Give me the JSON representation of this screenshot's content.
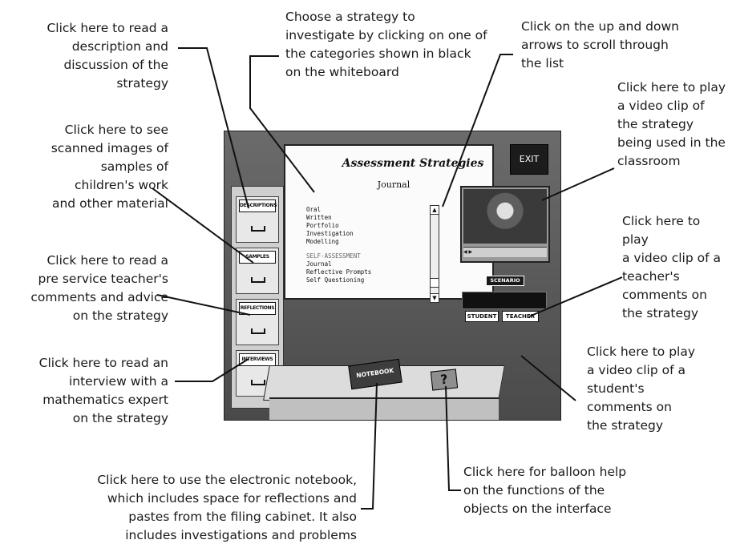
{
  "callouts": {
    "descriptions": "Click here to read a\ndescription and\ndiscussion of the\nstrategy",
    "samples": "Click here to see\nscanned images of\nsamples of\nchildren's work\nand other material",
    "reflections": "Click here to read a\npre service teacher's\ncomments and advice\non the strategy",
    "interviews": "Click here to read an\ninterview with a\nmathematics expert\non the strategy",
    "choose": "Choose a strategy to\ninvestigate by clicking on one of\nthe categories shown in black\non the whiteboard",
    "scroll": "Click on the up and down\narrows to scroll through\nthe list",
    "scenario": "Click here to play\na video clip of\nthe strategy\nbeing used in the\nclassroom",
    "teacher": "Click here to play\na video clip of a\nteacher's\ncomments on\nthe strategy",
    "student": "Click here to play\na video clip of a\nstudent's\ncomments on\nthe strategy",
    "notebook": "Click here to use the electronic notebook,\nwhich includes space for reflections and\npastes from the filing cabinet. It also\nincludes investigations and problems",
    "help": "Click here for balloon help\non the functions of the\nobjects on the interface"
  },
  "interface": {
    "whiteboard_title": "Assessment Strategies",
    "whiteboard_subtitle": "Journal",
    "list_items": [
      "Oral",
      "Written",
      "Portfolio",
      "Investigation",
      "Modelling"
    ],
    "section_header": "SELF-ASSESSMENT",
    "section_items": [
      "Journal",
      "Reflective Prompts",
      "Self Questioning"
    ],
    "exit_label": "EXIT",
    "drawers": [
      "DESCRIPTIONS",
      "SAMPLES",
      "REFLECTIONS",
      "INTERVIEWS"
    ],
    "scenario_label": "SCENARIO",
    "student_label": "STUDENT",
    "teacher_label": "TEACHER",
    "notebook_label": "NOTEBOOK",
    "help_glyph": "?"
  }
}
